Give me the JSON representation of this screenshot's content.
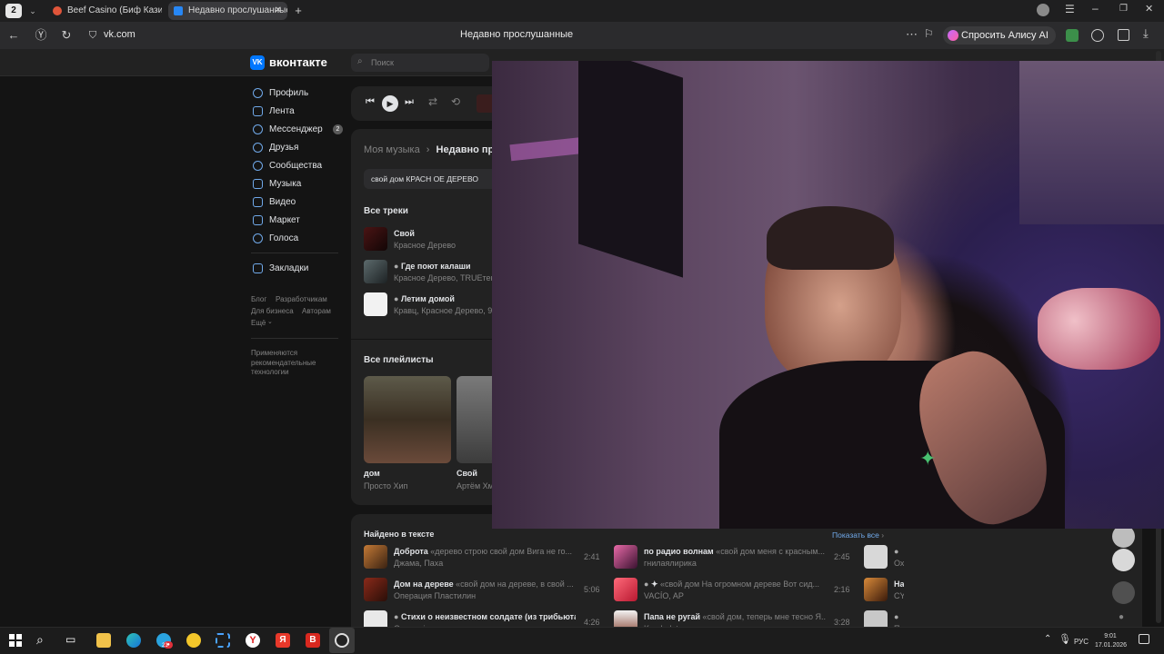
{
  "browser": {
    "tab_count_badge": "2",
    "tabs": [
      {
        "title": "Beef Casino (Биф Казино)"
      },
      {
        "title": "Недавно прослушанные"
      }
    ],
    "address": "vk.com",
    "page_title": "Недавно прослушанные",
    "alisa_label": "Спросить Алису AI"
  },
  "vk": {
    "logo_text": "вконтакте",
    "search_placeholder": "Поиск",
    "nav": [
      {
        "label": "Профиль"
      },
      {
        "label": "Лента"
      },
      {
        "label": "Мессенджер",
        "badge": "2"
      },
      {
        "label": "Друзья"
      },
      {
        "label": "Сообщества"
      },
      {
        "label": "Музыка"
      },
      {
        "label": "Видео"
      },
      {
        "label": "Маркет"
      },
      {
        "label": "Голоса"
      },
      {
        "label": "Закладки"
      }
    ],
    "footer_links": [
      "Блог",
      "Разработчикам",
      "Для бизнеса",
      "Авторам",
      "Ещё"
    ],
    "recommend_note": "Применяются рекомендательные технологии",
    "breadcrumb": {
      "parent": "Моя музыка",
      "current": "Недавно про"
    },
    "search_value": "свой дом КРАСН ОЕ ДЕРЕВО",
    "all_tracks_heading": "Все треки",
    "tracks": [
      {
        "title": "Свой",
        "artist": "Красное Дерево"
      },
      {
        "title": "Где поют калаши",
        "artist": "Красное Дерево, TRUEтень"
      },
      {
        "title": "Летим домой",
        "artist": "Кравц, Красное Дерево, 9"
      }
    ],
    "all_playlists_heading": "Все плейлисты",
    "playlists": [
      {
        "title": "дом",
        "author": "Просто Хип"
      },
      {
        "title": "Свой",
        "author": "Артём Хм"
      }
    ],
    "found_in_text_heading": "Найдено в тексте",
    "show_all": "Показать все",
    "found_tracks": [
      {
        "title": "Доброта",
        "lyric": "«дерево строю свой дом Вига не го...",
        "artist": "Джама, Паха",
        "duration": "2:41"
      },
      {
        "title": "по радио волнам",
        "lyric": "«свой дом меня с красным...",
        "artist": "гнилаялирика",
        "duration": "2:45"
      },
      {
        "title": "Дом на дереве",
        "lyric": "«свой дом на дереве, в свой ...",
        "artist": "Операция Пластилин",
        "duration": "5:06"
      },
      {
        "title": "✦",
        "lyric": "«свой дом На огромном дереве Вот сид...",
        "artist": "VACÍO, AP",
        "duration": "2:16"
      },
      {
        "title": "Стихи о неизвестном солдате (из трибьюта...",
        "lyric": "",
        "artist": "Oxxxymiron",
        "duration": "4:26"
      },
      {
        "title": "Папа не ругай",
        "lyric": "«свой дом, теперь мне тесно Я...",
        "artist": "Kambulat",
        "duration": "3:28"
      }
    ],
    "partial_right": [
      {
        "title": "",
        "artist": "Ох"
      },
      {
        "title": "На",
        "artist": "CY"
      },
      {
        "title": "",
        "artist": "Пи"
      }
    ]
  },
  "taskbar": {
    "lang": "РУС",
    "time": "9:01",
    "date": "17.01.2026",
    "yandex_badge": "21"
  }
}
